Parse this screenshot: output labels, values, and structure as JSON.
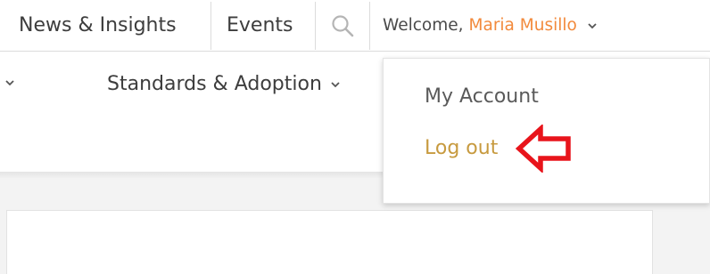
{
  "topbar": {
    "news_insights": "News & Insights",
    "events": "Events",
    "welcome_prefix": "Welcome,",
    "user_name": "Maria Musillo"
  },
  "nav": {
    "standards_adoption": "Standards & Adoption"
  },
  "account_menu": {
    "my_account": "My Account",
    "log_out": "Log out"
  },
  "colors": {
    "user_name": "#f28a3c",
    "log_out": "#c79a3f",
    "annotation_arrow": "#e8141b"
  },
  "icons": {
    "search": "search-icon",
    "dropdown": "chevron-down-icon",
    "annotation": "arrow-left-icon"
  }
}
